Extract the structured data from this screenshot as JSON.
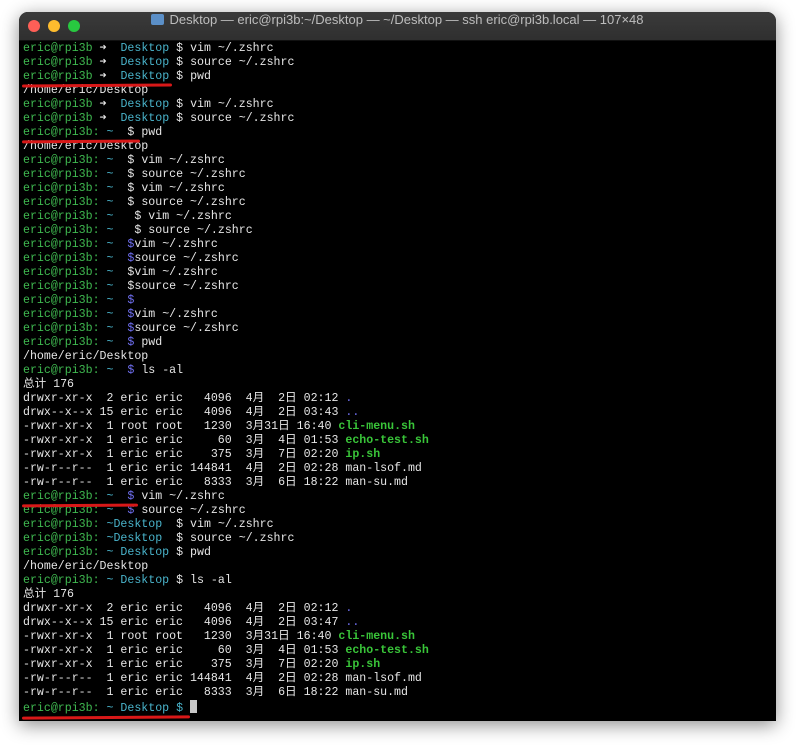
{
  "window": {
    "title": "Desktop — eric@rpi3b:~/Desktop — ~/Desktop — ssh eric@rpi3b.local — 107×48"
  },
  "colors": {
    "prompt_green": "#3fb950",
    "dir_cyan": "#49b3ca",
    "dollar_blue": "#6f6ff2",
    "exec_green": "#39c539",
    "annotation_red": "#d81818"
  },
  "prompts": {
    "user": "eric@rpi3b",
    "arrow": "➜",
    "tilde": "~",
    "dollar": "$",
    "colon": ":",
    "desktop": "Desktop",
    "tilde_desktop": "~Desktop",
    "tilde_sp_desktop": "~ Desktop"
  },
  "commands": {
    "vim": "vim ~/.zshrc",
    "source": "source ~/.zshrc",
    "pwd": "pwd",
    "ls": "ls -al"
  },
  "output": {
    "pwd_result": "/home/eric/Desktop",
    "total": "总计 176"
  },
  "listing1": [
    {
      "perm": "drwxr-xr-x",
      "links": "2",
      "owner": "eric",
      "group": "eric",
      "size": "4096",
      "date": "4月  2日",
      "time": "02:12",
      "name": "."
    },
    {
      "perm": "drwx--x--x",
      "links": "15",
      "owner": "eric",
      "group": "eric",
      "size": "4096",
      "date": "4月  2日",
      "time": "03:43",
      "name": ".."
    },
    {
      "perm": "-rwxr-xr-x",
      "links": "1",
      "owner": "root",
      "group": "root",
      "size": "1230",
      "date": "3月31日",
      "time": "16:40",
      "name": "cli-menu.sh"
    },
    {
      "perm": "-rwxr-xr-x",
      "links": "1",
      "owner": "eric",
      "group": "eric",
      "size": "60",
      "date": "3月  4日",
      "time": "01:53",
      "name": "echo-test.sh"
    },
    {
      "perm": "-rwxr-xr-x",
      "links": "1",
      "owner": "eric",
      "group": "eric",
      "size": "375",
      "date": "3月  7日",
      "time": "02:20",
      "name": "ip.sh"
    },
    {
      "perm": "-rw-r--r--",
      "links": "1",
      "owner": "eric",
      "group": "eric",
      "size": "144841",
      "date": "4月  2日",
      "time": "02:28",
      "name": "man-lsof.md"
    },
    {
      "perm": "-rw-r--r--",
      "links": "1",
      "owner": "eric",
      "group": "eric",
      "size": "8333",
      "date": "3月  6日",
      "time": "18:22",
      "name": "man-su.md"
    }
  ],
  "listing2": [
    {
      "perm": "drwxr-xr-x",
      "links": "2",
      "owner": "eric",
      "group": "eric",
      "size": "4096",
      "date": "4月  2日",
      "time": "02:12",
      "name": "."
    },
    {
      "perm": "drwx--x--x",
      "links": "15",
      "owner": "eric",
      "group": "eric",
      "size": "4096",
      "date": "4月  2日",
      "time": "03:47",
      "name": ".."
    },
    {
      "perm": "-rwxr-xr-x",
      "links": "1",
      "owner": "root",
      "group": "root",
      "size": "1230",
      "date": "3月31日",
      "time": "16:40",
      "name": "cli-menu.sh"
    },
    {
      "perm": "-rwxr-xr-x",
      "links": "1",
      "owner": "eric",
      "group": "eric",
      "size": "60",
      "date": "3月  4日",
      "time": "01:53",
      "name": "echo-test.sh"
    },
    {
      "perm": "-rwxr-xr-x",
      "links": "1",
      "owner": "eric",
      "group": "eric",
      "size": "375",
      "date": "3月  7日",
      "time": "02:20",
      "name": "ip.sh"
    },
    {
      "perm": "-rw-r--r--",
      "links": "1",
      "owner": "eric",
      "group": "eric",
      "size": "144841",
      "date": "4月  2日",
      "time": "02:28",
      "name": "man-lsof.md"
    },
    {
      "perm": "-rw-r--r--",
      "links": "1",
      "owner": "eric",
      "group": "eric",
      "size": "8333",
      "date": "3月  6日",
      "time": "18:22",
      "name": "man-su.md"
    }
  ]
}
